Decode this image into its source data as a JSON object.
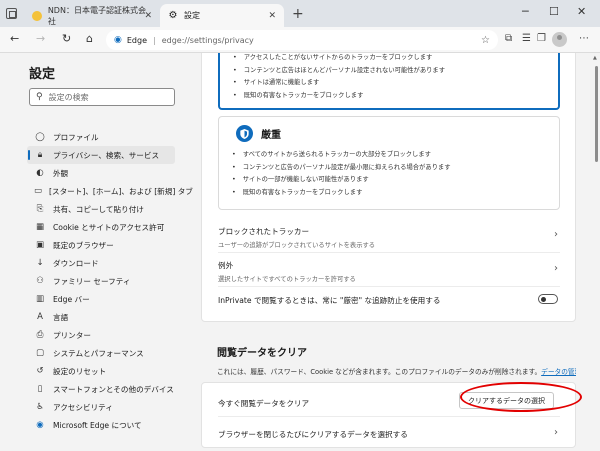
{
  "tabs": [
    {
      "label": "NDN：日本電子認証株式会社",
      "favicon": "ndn-favicon",
      "active": false
    },
    {
      "label": "設定",
      "favicon": "gear-icon",
      "active": true
    }
  ],
  "address": {
    "site_label": "Edge",
    "url": "edge://settings/privacy"
  },
  "sidebar": {
    "title": "設定",
    "search_placeholder": "設定の検索",
    "items": [
      {
        "label": "プロファイル",
        "icon": "profile-icon"
      },
      {
        "label": "プライバシー、検索、サービス",
        "icon": "lock-icon",
        "active": true
      },
      {
        "label": "外観",
        "icon": "appearance-icon"
      },
      {
        "label": "[スタート]、[ホーム]、および [新規] タブ",
        "icon": "home-tab-icon"
      },
      {
        "label": "共有、コピーして貼り付け",
        "icon": "share-icon"
      },
      {
        "label": "Cookie とサイトのアクセス許可",
        "icon": "cookie-icon"
      },
      {
        "label": "既定のブラウザー",
        "icon": "browser-icon"
      },
      {
        "label": "ダウンロード",
        "icon": "download-icon"
      },
      {
        "label": "ファミリー セーフティ",
        "icon": "family-icon"
      },
      {
        "label": "Edge バー",
        "icon": "edge-bar-icon"
      },
      {
        "label": "言語",
        "icon": "language-icon"
      },
      {
        "label": "プリンター",
        "icon": "printer-icon"
      },
      {
        "label": "システムとパフォーマンス",
        "icon": "system-icon"
      },
      {
        "label": "設定のリセット",
        "icon": "reset-icon"
      },
      {
        "label": "スマートフォンとその他のデバイス",
        "icon": "phone-icon"
      },
      {
        "label": "アクセシビリティ",
        "icon": "accessibility-icon"
      },
      {
        "label": "Microsoft Edge について",
        "icon": "edge-logo-icon"
      }
    ]
  },
  "tracking": {
    "balanced_bullets": [
      "アクセスしたことがないサイトからのトラッカーをブロックします",
      "コンテンツと広告はほとんどパーソナル設定されない可能性があります",
      "サイトは通常に機能します",
      "既知の有害なトラッカーをブロックします"
    ],
    "strict_title": "厳重",
    "strict_bullets": [
      "すべてのサイトから送られるトラッカーの大部分をブロックします",
      "コンテンツと広告のパーソナル設定が最小限に抑えられる場合があります",
      "サイトの一部が機能しない可能性があります",
      "既知の有害なトラッカーをブロックします"
    ],
    "blocked_title": "ブロックされたトラッカー",
    "blocked_sub": "ユーザーの追跡がブロックされているサイトを表示する",
    "exceptions_title": "例外",
    "exceptions_sub": "選択したサイトですべてのトラッカーを許可する",
    "inprivate_label": "InPrivate で閲覧するときは、常に \"厳密\" な追跡防止を使用する",
    "inprivate_on": false
  },
  "clear_data": {
    "title": "閲覧データをクリア",
    "desc": "これには、履歴、パスワード、Cookie などが含まれます。このプロファイルのデータのみが削除されます。",
    "link": "データの管理",
    "now_label": "今すぐ閲覧データをクリア",
    "button_label": "クリアするデータの選択",
    "on_close_label": "ブラウザーを閉じるたびにクリアするデータを選択する"
  },
  "colors": {
    "accent": "#0f6cbd",
    "highlight": "#e20000"
  }
}
